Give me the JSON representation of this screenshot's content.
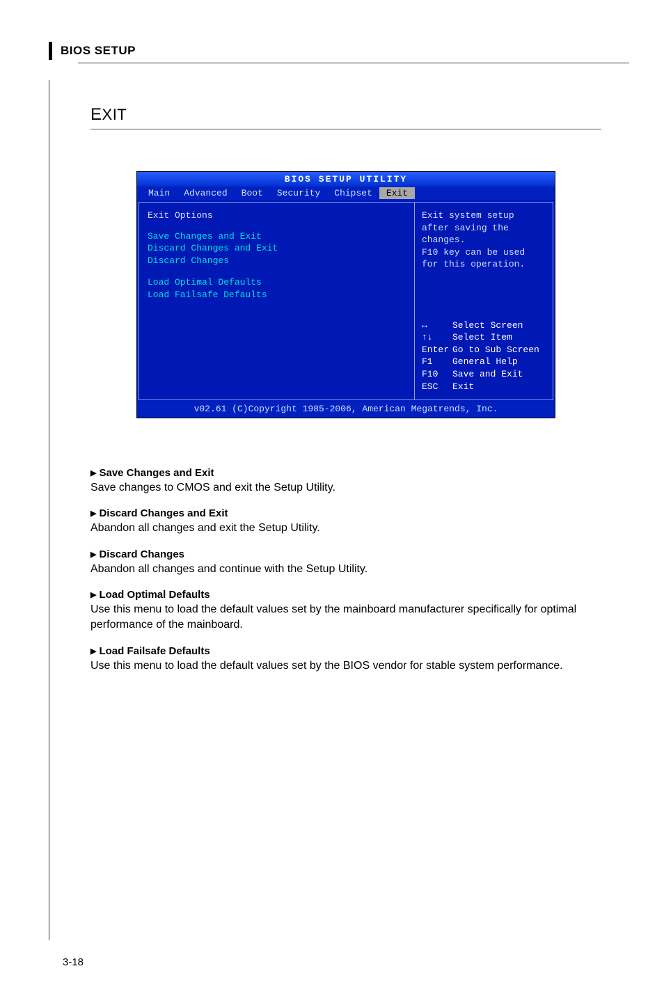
{
  "header": "BIOS SETUP",
  "section_title": "Exit",
  "page_number": "3-18",
  "bios": {
    "title": "BIOS SETUP UTILITY",
    "tabs": [
      "Main",
      "Advanced",
      "Boot",
      "Security",
      "Chipset",
      "Exit"
    ],
    "active_tab": "Exit",
    "left": {
      "heading": "Exit Options",
      "items_a": [
        "Save Changes and Exit",
        "Discard Changes and Exit",
        "Discard Changes"
      ],
      "items_b": [
        "Load Optimal Defaults",
        "Load Failsafe Defaults"
      ]
    },
    "help_top": [
      "Exit system setup",
      "after saving the",
      "changes.",
      "",
      "F10 key can be used",
      "for this operation."
    ],
    "keys": [
      {
        "k": "↔",
        "t": "Select Screen"
      },
      {
        "k": "↑↓",
        "t": "Select Item"
      },
      {
        "k": "Enter",
        "t": "Go to Sub Screen"
      },
      {
        "k": "F1",
        "t": "General Help"
      },
      {
        "k": "F10",
        "t": "Save and Exit"
      },
      {
        "k": "ESC",
        "t": "Exit"
      }
    ],
    "footer": "v02.61 (C)Copyright 1985-2006, American Megatrends, Inc."
  },
  "entries": [
    {
      "title": "Save Changes and Exit",
      "desc": "Save changes to CMOS and exit the Setup Utility."
    },
    {
      "title": "Discard Changes and Exit",
      "desc": "Abandon all changes and exit the Setup Utility."
    },
    {
      "title": "Discard Changes",
      "desc": "Abandon all changes and continue with the Setup Utility."
    },
    {
      "title": "Load Optimal Defaults",
      "desc": "Use this menu to load the default values set by the mainboard manufacturer specifically for optimal performance of the mainboard."
    },
    {
      "title": "Load Failsafe Defaults",
      "desc": "Use this menu to load the default values set by the BIOS vendor for stable system performance."
    }
  ]
}
